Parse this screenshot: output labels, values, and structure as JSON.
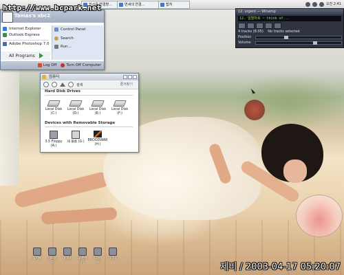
{
  "taskbar": {
    "tasks": [
      "전사를 연결할…",
      "연세대 연결…",
      "캡쳐"
    ],
    "tray_time": "오전 2:41"
  },
  "site_url": "http://www.bcpark.net",
  "start_menu": {
    "user": "Tamas's xbc2",
    "pinned": [
      {
        "label": "Internet Explorer",
        "icon": "ie-icon"
      },
      {
        "label": "Outlook Express",
        "icon": "mail-icon"
      },
      {
        "label": "Adobe Photoshop 7.0",
        "icon": "photoshop-icon"
      }
    ],
    "all_programs": "All Programs",
    "right_items": [
      {
        "label": "Control Panel",
        "icon": "control-panel-icon"
      },
      {
        "label": "Search",
        "icon": "search-icon"
      },
      {
        "label": "Run...",
        "icon": "run-icon"
      }
    ],
    "log_off": "Log Off",
    "turn_off": "Turn Off Computer"
  },
  "winamp": {
    "title": "12. urgent  —  Winamp",
    "display": "12. 일렬차로 ~ think of...",
    "tracks_info": "4 tracks (8:05)",
    "selection": "No tracks selected",
    "position_label": "Position",
    "volume_label": "Volume",
    "position": 0.35,
    "volume": 0.7
  },
  "explorer": {
    "title": "컴퓨터",
    "toolbar_search": "검색",
    "toolbar_favorites": "즐겨찾기",
    "hard_group": "Hard Disk Drives",
    "drives": [
      {
        "name": "Local Disk",
        "letter": "(C:)"
      },
      {
        "name": "Local Disk",
        "letter": "(D:)"
      },
      {
        "name": "Local Disk",
        "letter": "(E:)"
      },
      {
        "name": "Local Disk",
        "letter": "(F:)"
      }
    ],
    "removable_group": "Devices with Removable Storage",
    "removable": [
      {
        "name": "3.5 Floppy",
        "letter": "(A:)"
      },
      {
        "name": "새 볼륨 (G:)",
        "letter": ""
      },
      {
        "name": "BROODWAR",
        "letter": "(H:)"
      }
    ]
  },
  "desktop_icons": [
    "휴지통",
    "네트워크",
    "내 문서",
    "내 컴퓨터",
    "드라이브",
    "내 그림"
  ],
  "clock_text": "제비 / 2003-04-17 05:20:07"
}
